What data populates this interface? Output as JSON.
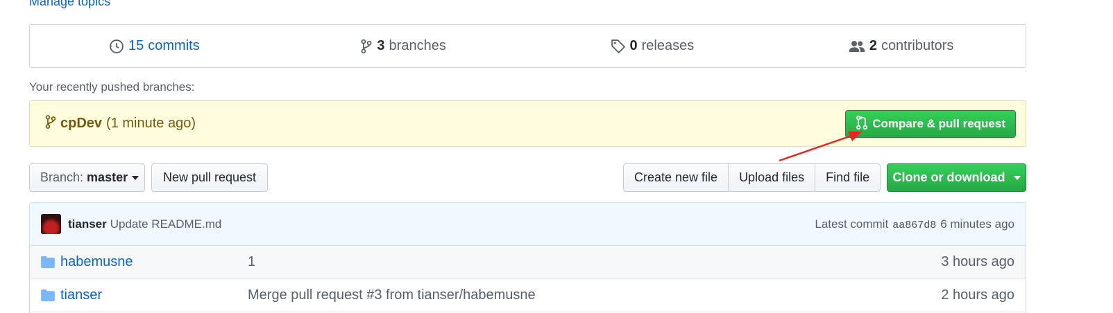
{
  "manage_topics": "Manage topics",
  "summary": {
    "commits": {
      "count": "15",
      "label": "commits"
    },
    "branches": {
      "count": "3",
      "label": "branches"
    },
    "releases": {
      "count": "0",
      "label": "releases"
    },
    "contributors": {
      "count": "2",
      "label": "contributors"
    }
  },
  "recent": {
    "label": "Your recently pushed branches:",
    "branch": "cpDev",
    "time": "(1 minute ago)",
    "compare_button": "Compare & pull request"
  },
  "file_nav": {
    "branch_prefix": "Branch:",
    "branch_name": "master",
    "new_pull_request": "New pull request",
    "create_new_file": "Create new file",
    "upload_files": "Upload files",
    "find_file": "Find file",
    "clone_or_download": "Clone or download"
  },
  "commit_tease": {
    "author": "tianser",
    "message": "Update README.md",
    "latest_label": "Latest commit",
    "sha": "aa867d8",
    "time": "6 minutes ago"
  },
  "files": [
    {
      "name": "habemusne",
      "message": "1",
      "age": "3 hours ago",
      "icon": "folder-icon"
    },
    {
      "name": "tianser",
      "message": "Merge pull request #3 from tianser/habemusne",
      "age": "2 hours ago",
      "icon": "folder-icon"
    }
  ],
  "colors": {
    "link": "#0366d6",
    "green": "#28a745",
    "banner_bg": "#fffbdd",
    "annotation_red": "#e8261e"
  }
}
